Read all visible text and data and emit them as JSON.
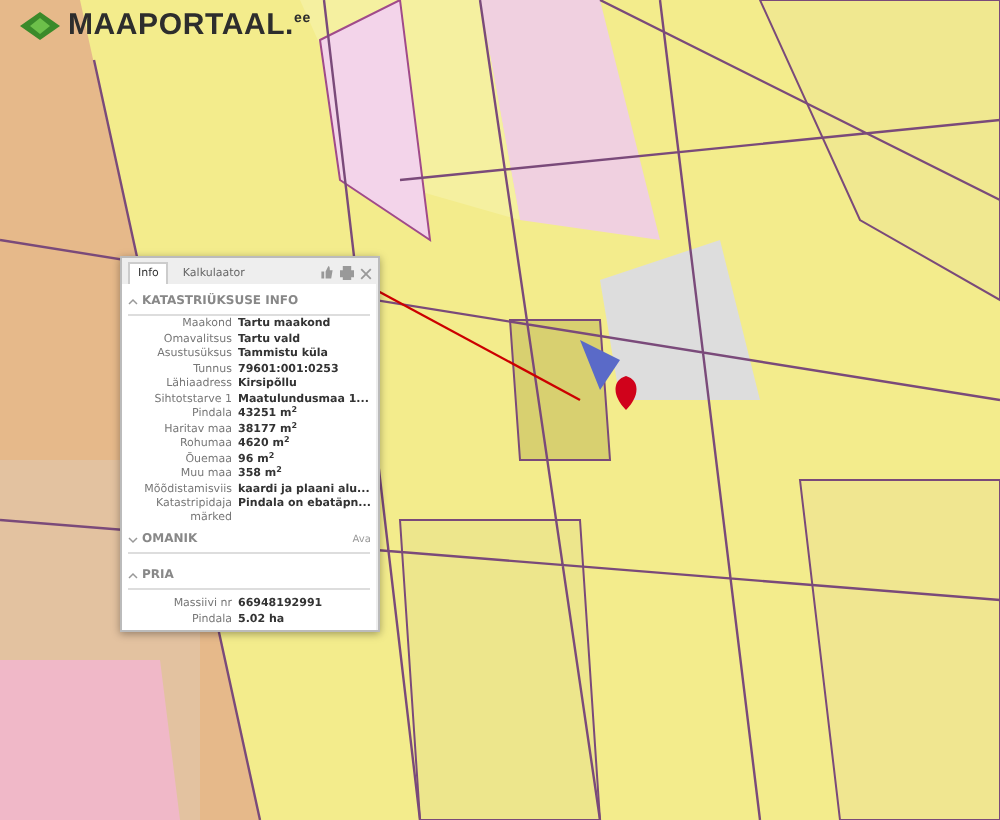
{
  "logo": {
    "text": "MAAPORTAAL.$^{ee}$"
  },
  "popup": {
    "tabs": [
      {
        "label": "Info",
        "selected": true
      },
      {
        "label": "Kalkulaator",
        "selected": false
      }
    ],
    "sections": [
      {
        "title": "KATASTRIÜKSUSE INFO",
        "expanded": true,
        "rows": [
          {
            "label": "Maakond",
            "value": "Tartu maakond"
          },
          {
            "label": "Omavalitsus",
            "value": "Tartu vald"
          },
          {
            "label": "Asustusüksus",
            "value": "Tammistu küla"
          },
          {
            "label": "Tunnus",
            "value": "79601:001:0253"
          },
          {
            "label": "Lähiaadress",
            "value": "Kirsipõllu"
          },
          {
            "label": "Sihtotstarve 1",
            "value": "Maatulundusmaa 1..."
          },
          {
            "label": "Pindala",
            "value": "43251 m$^{2}$"
          },
          {
            "label": "Haritav maa",
            "value": "38177 m$^{2}$"
          },
          {
            "label": "Rohumaa",
            "value": "4620 m$^{2}$"
          },
          {
            "label": "Õuemaa",
            "value": "96 m$^{2}$"
          },
          {
            "label": "Muu maa",
            "value": "358 m$^{2}$"
          },
          {
            "label": "Mõõdistamisviis",
            "value": "kaardi ja plaani alu..."
          },
          {
            "label": "Katastripidaja märked",
            "value": "Pindala on ebatäpn..."
          }
        ]
      },
      {
        "title": "OMANIK",
        "expanded": false,
        "action": "Ava"
      },
      {
        "title": "PRIA",
        "expanded": true,
        "rows": [
          {
            "label": "Massiivi nr",
            "value": "66948192991"
          },
          {
            "label": "Pindala",
            "value": "5.02 ha"
          }
        ]
      }
    ]
  }
}
